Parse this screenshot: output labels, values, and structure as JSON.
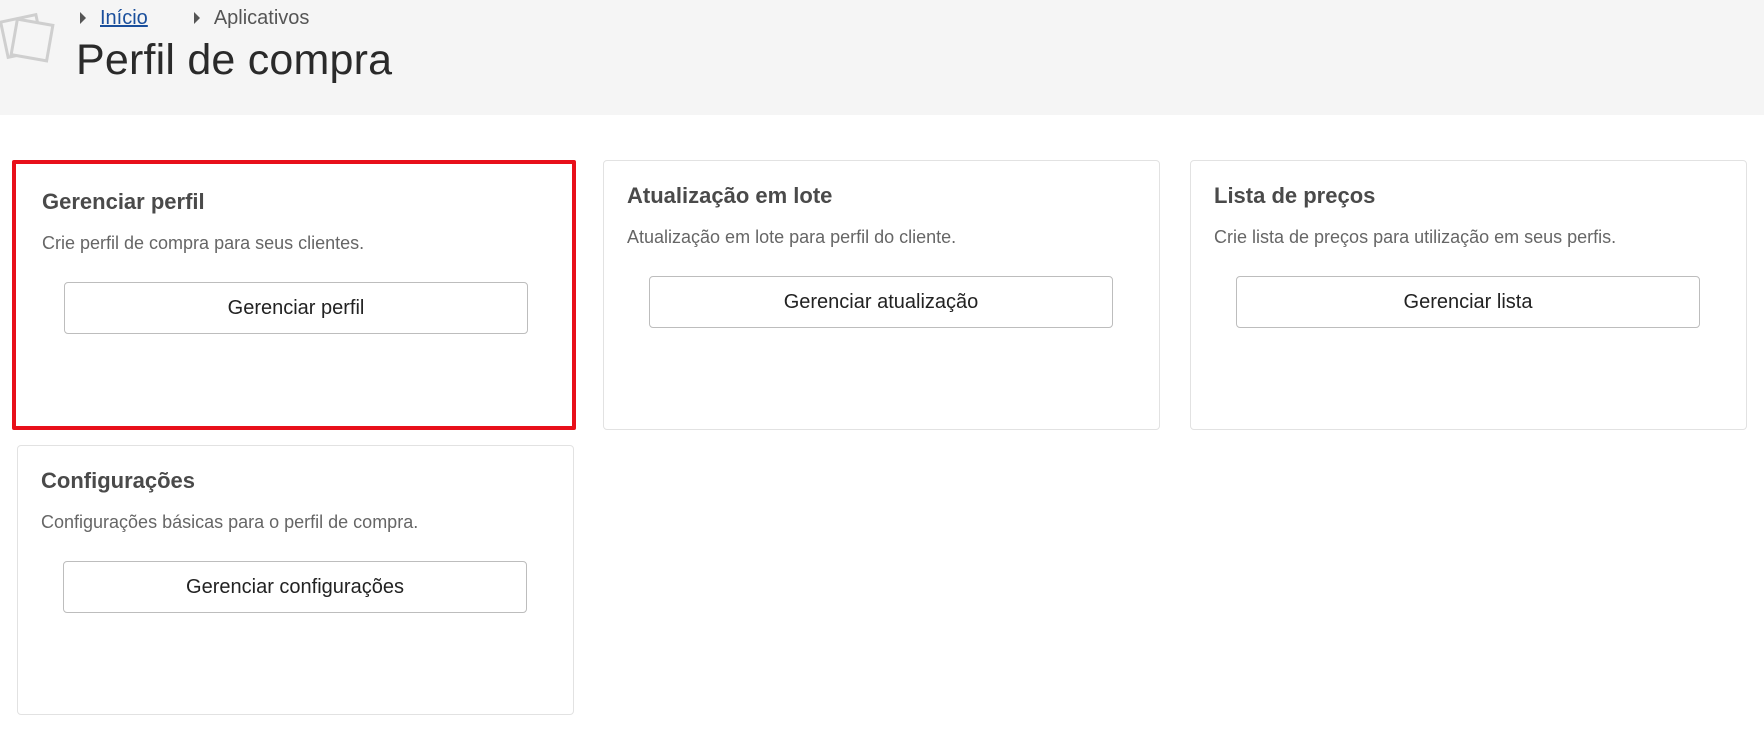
{
  "breadcrumb": {
    "home": "Início",
    "current": "Aplicativos"
  },
  "page": {
    "title": "Perfil de compra"
  },
  "cards": [
    {
      "title": "Gerenciar perfil",
      "description": "Crie perfil de compra para seus clientes.",
      "button": "Gerenciar perfil",
      "selected": true
    },
    {
      "title": "Atualização em lote",
      "description": "Atualização em lote para perfil do cliente.",
      "button": "Gerenciar atualização",
      "selected": false
    },
    {
      "title": "Lista de preços",
      "description": "Crie lista de preços para utilização em seus perfis.",
      "button": "Gerenciar lista",
      "selected": false
    },
    {
      "title": "Configurações",
      "description": "Configurações básicas para o perfil de compra.",
      "button": "Gerenciar configurações",
      "selected": false
    }
  ],
  "colors": {
    "header_bg": "#f5f5f5",
    "selection_border": "#e8101a",
    "link": "#1a4f9c"
  },
  "icons": {
    "logo": "stacked-squares-logo-icon",
    "breadcrumb_separator": "caret-right-icon"
  }
}
